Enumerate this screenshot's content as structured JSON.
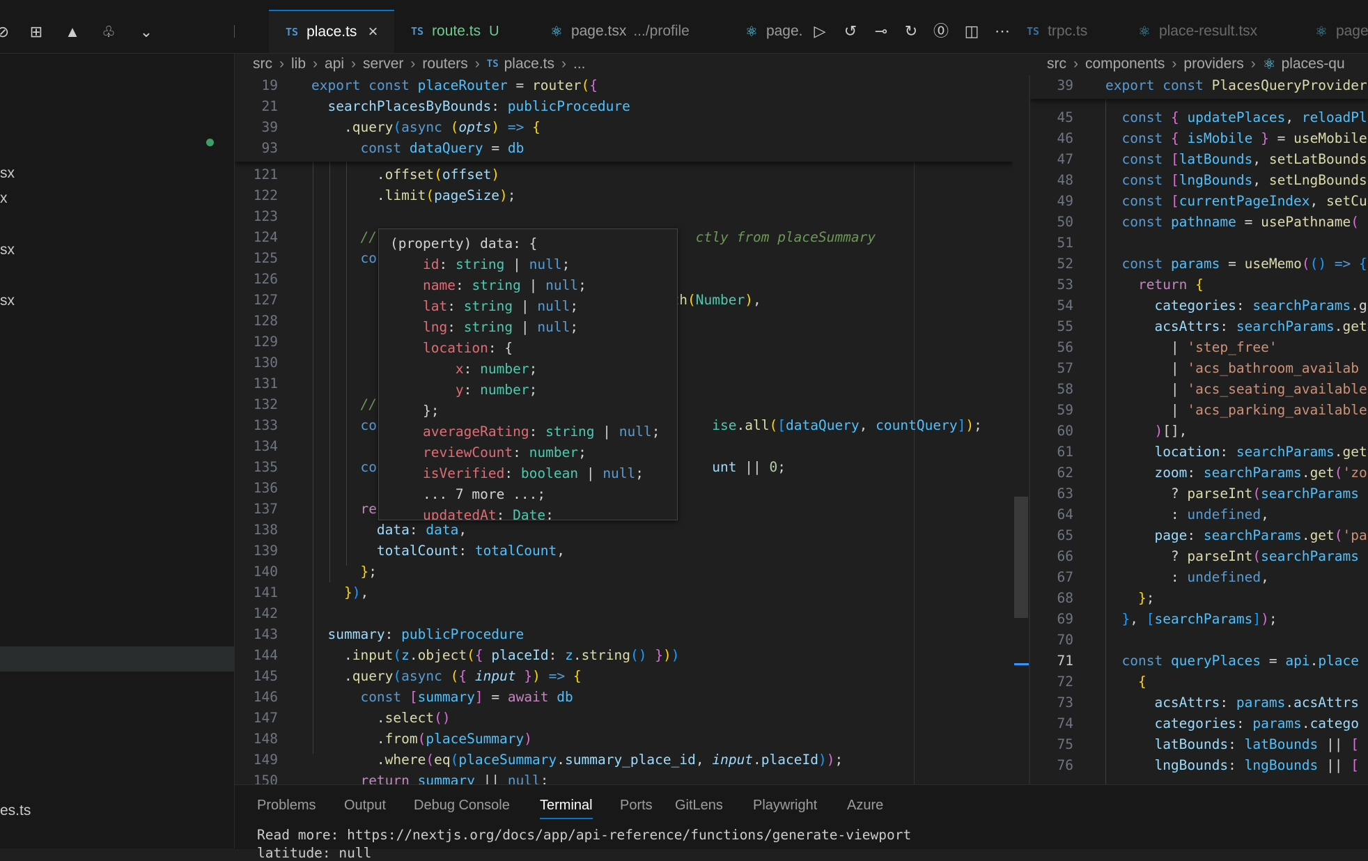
{
  "activity_icons": [
    "extensions-icon",
    "remote-explorer-icon",
    "vercel-icon",
    "tree-icon",
    "chevron-down-icon"
  ],
  "tabs": [
    {
      "name": "place.ts",
      "kind": "ts",
      "active": true
    },
    {
      "name": "route.ts",
      "kind": "ts",
      "git": "U"
    },
    {
      "name": "page.tsx",
      "kind": "react",
      "desc": ".../profile"
    },
    {
      "name": "page.",
      "kind": "react"
    },
    {
      "name": "trpc.ts",
      "kind": "ts"
    },
    {
      "name": "place-result.tsx",
      "kind": "react"
    },
    {
      "name": "page",
      "kind": "react"
    }
  ],
  "sidebar": {
    "items": [
      "sx",
      "x",
      "sx",
      "sx",
      "es.ts"
    ]
  },
  "left_breadcrumb": [
    "src",
    "lib",
    "api",
    "server",
    "routers",
    "place.ts",
    "..."
  ],
  "right_breadcrumb": [
    "src",
    "components",
    "providers",
    "places-qu"
  ],
  "left_line_numbers": [
    "121",
    "122",
    "123",
    "124",
    "125",
    "126",
    "127",
    "128",
    "129",
    "130",
    "131",
    "132",
    "133",
    "134",
    "135",
    "136",
    "137",
    "138",
    "139",
    "140",
    "141",
    "142",
    "143",
    "144",
    "145",
    "146",
    "147",
    "148",
    "149",
    "150"
  ],
  "left_sticky_numbers": [
    "19",
    "21",
    "39",
    "93"
  ],
  "right_line_numbers": [
    "39",
    "45",
    "46",
    "47",
    "48",
    "49",
    "50",
    "51",
    "52",
    "53",
    "54",
    "55",
    "56",
    "57",
    "58",
    "59",
    "60",
    "61",
    "62",
    "63",
    "64",
    "65",
    "66",
    "67",
    "68",
    "69",
    "70",
    "71",
    "72",
    "73",
    "74",
    "75",
    "76"
  ],
  "hover_header": "(property) data: {",
  "hover_more": "... 7 more ...;",
  "panel": {
    "tabs": [
      "Problems",
      "Output",
      "Debug Console",
      "Terminal",
      "Ports",
      "GitLens",
      "Playwright",
      "Azure"
    ],
    "active_tab": "Terminal",
    "terminal_line": "Read more: https://nextjs.org/docs/app/api-reference/functions/generate-viewport",
    "terminal_line2": "latitude: null"
  },
  "colors": {
    "editor_bg": "#1f1f1f",
    "chrome_bg": "#181818",
    "accent": "#0078d4"
  }
}
